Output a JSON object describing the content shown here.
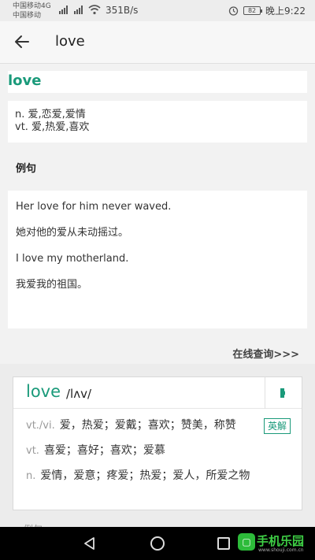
{
  "status_bar": {
    "carrier_1": "中国移动4G",
    "carrier_2": "中国移动",
    "net_speed": "351B/s",
    "battery": "82",
    "time": "晚上9:22"
  },
  "app_bar": {
    "title": "love",
    "back_icon": "back-arrow-icon"
  },
  "entry": {
    "headword": "love",
    "definitions": [
      "n. 爱,恋爱,爱情",
      "vt. 爱,热爱,喜欢"
    ]
  },
  "examples": {
    "heading": "例句",
    "items": [
      "Her love for him never waved.",
      "她对他的爱从未动摇过。",
      "I love my motherland.",
      "我爱我的祖国。"
    ]
  },
  "online_lookup": "在线查询>>>",
  "popup": {
    "word": "love",
    "phonetic": "/lʌv/",
    "speaker_icon": "speaker-icon",
    "english_def_button": "英解",
    "senses": [
      {
        "pos": "vt./vi.",
        "meaning": "爱，热爱；爱戴；喜欢；赞美，称赞"
      },
      {
        "pos": "vt.",
        "meaning": "喜爱；喜好；喜欢；爱慕"
      },
      {
        "pos": "n.",
        "meaning": "爱情，爱意；疼爱；热爱；爱人，所爱之物"
      }
    ],
    "peek_text": "例句"
  },
  "watermark": {
    "text": "手机乐园",
    "domain": "www.shouji.com.cn"
  },
  "colors": {
    "accent": "#1a9a7a",
    "background": "#f2f2f2",
    "card": "#ffffff",
    "navbar": "#000000"
  }
}
